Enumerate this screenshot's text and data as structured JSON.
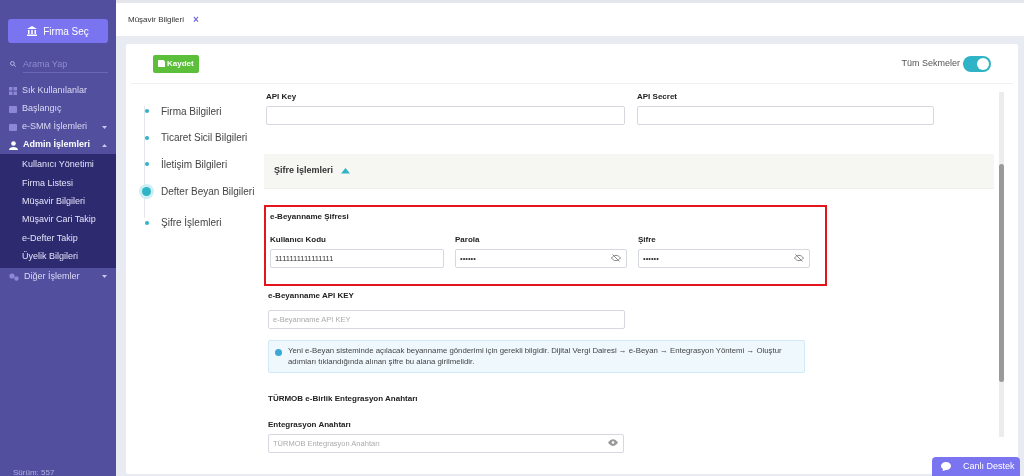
{
  "sidebar": {
    "firm_button": "Firma Seç",
    "search_placeholder": "Arama Yap",
    "items": [
      {
        "label": "Sık Kullanılanlar",
        "selected": false
      },
      {
        "label": "Başlangıç",
        "selected": false
      },
      {
        "label": "e-SMM İşlemleri",
        "selected": false,
        "expanded": false
      },
      {
        "label": "Admin İşlemleri",
        "selected": true,
        "expanded": true,
        "children": [
          {
            "label": "Kullanıcı Yönetimi"
          },
          {
            "label": "Firma Listesi"
          },
          {
            "label": "Müşavir Bilgileri"
          },
          {
            "label": "Müşavir Cari Takip"
          },
          {
            "label": "e-Defter Takip"
          },
          {
            "label": "Üyelik Bilgileri"
          }
        ]
      },
      {
        "label": "Diğer İşlemler",
        "selected": false,
        "expanded": false
      }
    ],
    "version": "Sürüm: 557"
  },
  "tabs": [
    {
      "label": "Müşavir Bilgileri",
      "close": "×"
    }
  ],
  "card": {
    "save_button": "Kaydet",
    "toggle": {
      "label": "Tüm Sekmeler",
      "on": true
    },
    "steps": [
      {
        "label": "Firma Bilgileri",
        "selected": false
      },
      {
        "label": "Ticaret Sicil Bilgileri",
        "selected": false
      },
      {
        "label": "İletişim Bilgileri",
        "selected": false
      },
      {
        "label": "Defter Beyan Bilgileri",
        "selected": true
      },
      {
        "label": "Şifre İşlemleri",
        "selected": false
      }
    ],
    "api_fields": [
      {
        "label": "API Key"
      },
      {
        "label": "API Secret"
      }
    ],
    "section": {
      "title": "Şifre İşlemleri",
      "expanded": true
    },
    "password_group": {
      "title": "e-Beyanname Şifresi",
      "highlighted": true,
      "fields": [
        {
          "label": "Kullanıcı Kodu",
          "value": "1111111111111111"
        },
        {
          "label": "Parola",
          "value": "••••••",
          "masked": true
        },
        {
          "label": "Şifre",
          "value": "••••••",
          "masked": true
        }
      ]
    },
    "api_key": {
      "title": "e-Beyanname API KEY",
      "placeholder": "e-Beyanname API KEY"
    },
    "info": "Yeni e-Beyan sisteminde açılacak beyanname gönderimi için gerekli bilgidir. Dijital Vergi Dairesi → e-Beyan → Entegrasyon Yöntemi → Oluştur adımları tıklandığında alınan şifre bu alana girilmelidir.",
    "turmob": {
      "title": "TÜRMOB e-Birlik Entegrasyon Anahtarı",
      "label": "Entegrasyon Anahtarı",
      "placeholder": "TÜRMOB Entegrasyon Anahtarı",
      "masked": false
    }
  },
  "chat_button": "Canlı Destek"
}
